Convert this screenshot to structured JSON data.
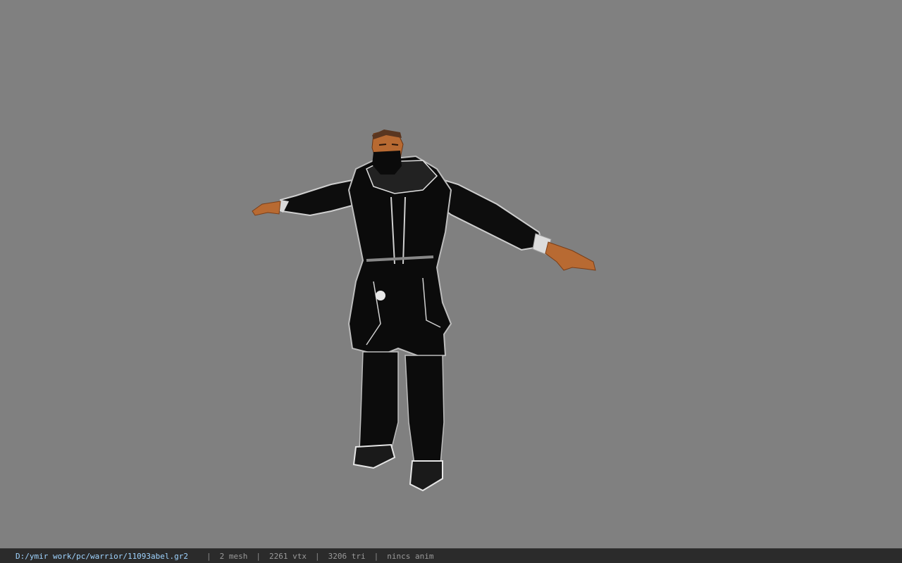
{
  "viewer": {
    "background": "#808080",
    "model_colors": {
      "armor": "#0c0c0c",
      "trim": "#d9d9d9",
      "skin": "#b86a32",
      "hair": "#5a3620"
    }
  },
  "statusbar": {
    "file_path": "D:/ymir work/pc/warrior/11093abel.gr2",
    "separator": "|",
    "mesh_count": "2 mesh",
    "vertex_count": "2261 vtx",
    "triangle_count": "3206 tri",
    "anim_state": "nincs anim",
    "path_color": "#9fd4ff"
  }
}
